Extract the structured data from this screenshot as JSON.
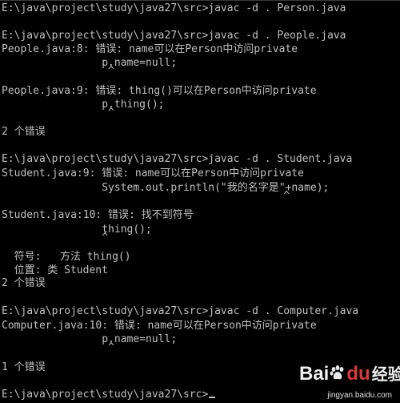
{
  "console": {
    "lines": [
      "E:\\java\\project\\study\\java27\\src>javac -d . Person.java",
      "",
      "E:\\java\\project\\study\\java27\\src>javac -d . People.java",
      "People.java:8: 错误: name可以在Person中访问private",
      "                p.name=null;",
      "                 ^",
      "",
      "People.java:9: 错误: thing()可以在Person中访问private",
      "                p.thing();",
      "                 ^",
      "",
      "2 个错误",
      "",
      "E:\\java\\project\\study\\java27\\src>javac -d . Student.java",
      "Student.java:9: 错误: name可以在Person中访问private",
      "                System.out.println(\"我的名字是\"+name);",
      "                                             ^",
      "",
      "Student.java:10: 错误: 找不到符号",
      "                thing();",
      "                ^",
      "",
      "  符号:   方法 thing()",
      "  位置: 类 Student",
      "2 个错误",
      "",
      "E:\\java\\project\\study\\java27\\src>javac -d . Computer.java",
      "Computer.java:10: 错误: name可以在Person中访问private",
      "                p.name=null;",
      "                 ^",
      "",
      "1 个错误",
      "",
      "E:\\java\\project\\study\\java27\\src>"
    ]
  },
  "watermark": {
    "logo_bai": "Bai",
    "logo_du": "du",
    "logo_jingyan": "经验",
    "url": "jingyan.baidu.com"
  },
  "colors": {
    "background": "#000000",
    "text": "#c0c0c0"
  }
}
